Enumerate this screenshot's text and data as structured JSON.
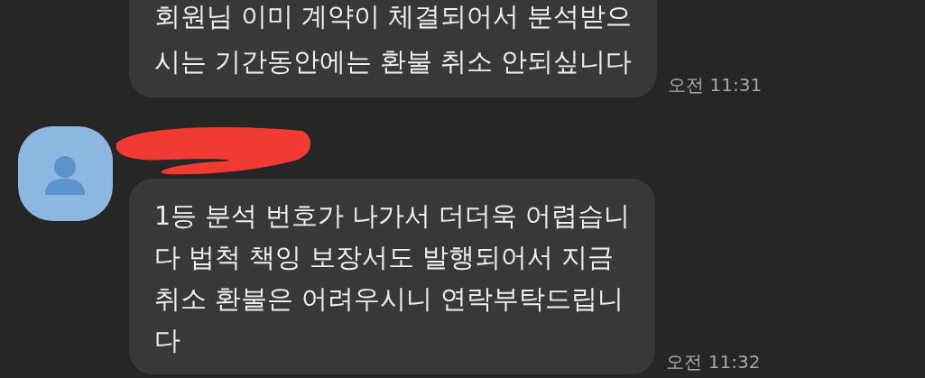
{
  "messages": [
    {
      "show_avatar": false,
      "sender_redacted": false,
      "lines": [
        "회원님 이미 계약이 체결되어서 분석받으",
        "시는 기간동안에는 환불 취소 안되싶니다"
      ],
      "time": "오전 11:31"
    },
    {
      "show_avatar": true,
      "sender_redacted": true,
      "lines": [
        "1등 분석 번호가 나가서 더더욱 어렵습니",
        "다 법척 책잉 보장서도 발행되어서 지금",
        "취소 환불은 어려우시니 연락부탁드립니",
        "다"
      ],
      "time": "오전 11:32"
    }
  ]
}
